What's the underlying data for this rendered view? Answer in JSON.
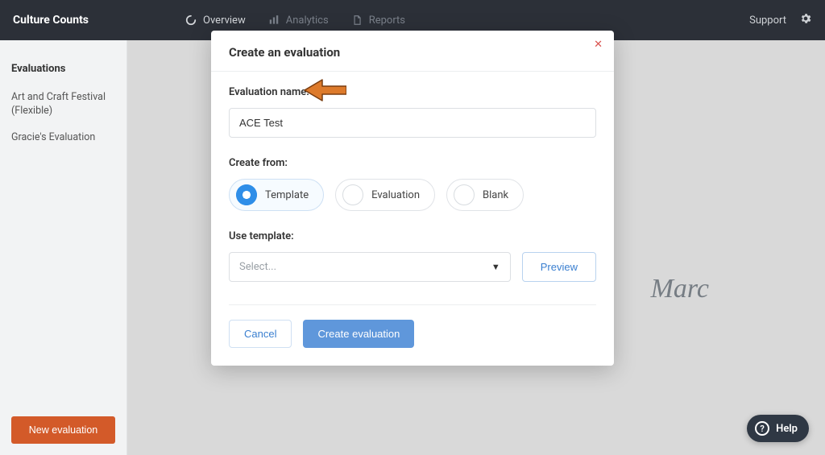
{
  "brand": "Culture Counts",
  "nav": {
    "overview": "Overview",
    "analytics": "Analytics",
    "reports": "Reports",
    "support": "Support"
  },
  "sidebar": {
    "heading": "Evaluations",
    "items": [
      "Art and Craft Festival (Flexible)",
      "Gracie's Evaluation"
    ],
    "new_button": "New evaluation"
  },
  "background_text": "Marc",
  "modal": {
    "title": "Create an evaluation",
    "name_label": "Evaluation name:",
    "name_value": "ACE Test",
    "create_from_label": "Create from:",
    "options": {
      "template": "Template",
      "evaluation": "Evaluation",
      "blank": "Blank",
      "selected": "template"
    },
    "use_template_label": "Use template:",
    "select_placeholder": "Select...",
    "preview": "Preview",
    "cancel": "Cancel",
    "create": "Create evaluation"
  },
  "help": {
    "label": "Help"
  }
}
